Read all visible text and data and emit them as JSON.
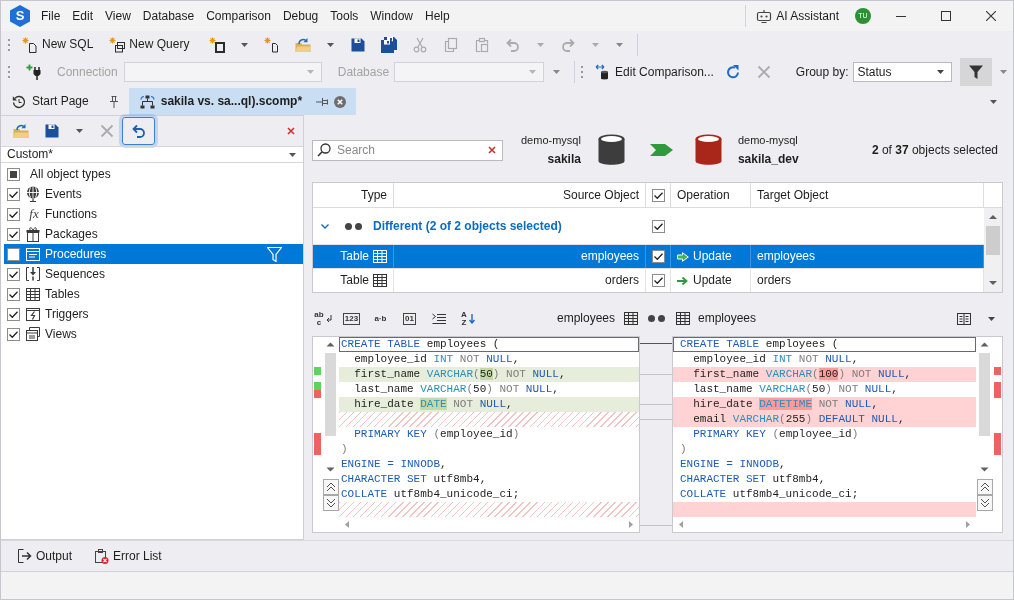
{
  "app": {
    "logo": "S",
    "menu": [
      "File",
      "Edit",
      "View",
      "Database",
      "Comparison",
      "Debug",
      "Tools",
      "Window",
      "Help"
    ],
    "assistant": "AI Assistant",
    "user_initials": "TU"
  },
  "main_toolbar": [
    {
      "kind": "new-sql",
      "label": "New SQL",
      "disabled": false,
      "dropdown": false
    },
    {
      "kind": "new-query",
      "label": "New Query",
      "disabled": false,
      "dropdown": false
    },
    {
      "kind": "new-window",
      "disabled": false,
      "dropdown": true
    },
    {
      "kind": "new-file",
      "disabled": false,
      "dropdown": false
    },
    {
      "kind": "open",
      "disabled": false,
      "dropdown": true
    },
    {
      "kind": "save",
      "disabled": false,
      "dropdown": false
    },
    {
      "kind": "save-all",
      "disabled": false,
      "dropdown": false
    },
    {
      "kind": "cut",
      "disabled": true,
      "dropdown": false
    },
    {
      "kind": "copy",
      "disabled": true,
      "dropdown": false
    },
    {
      "kind": "paste",
      "disabled": true,
      "dropdown": false
    },
    {
      "kind": "undo",
      "disabled": true,
      "dropdown": true
    },
    {
      "kind": "redo",
      "disabled": true,
      "dropdown": true
    }
  ],
  "comparison_toolbar": {
    "connection": {
      "label": "Connection",
      "disabled": true
    },
    "database": {
      "label": "Database",
      "disabled": true
    },
    "actions": [
      {
        "kind": "edit",
        "label": "Edit Comparison...",
        "disabled": false
      },
      {
        "kind": "refresh",
        "disabled": false
      },
      {
        "kind": "stop",
        "disabled": true
      }
    ],
    "group_by": {
      "label": "Group by:",
      "value": "Status"
    },
    "filter": {
      "on": true
    }
  },
  "document_tabs": [
    {
      "kind": "start",
      "label": "Start Page",
      "selected": false,
      "pinned": true
    },
    {
      "kind": "comparison",
      "label": "sakila vs. sa...ql).scomp*",
      "selected": true,
      "pinned": false
    }
  ],
  "object_types": {
    "tools": [
      {
        "kind": "open",
        "disabled": false,
        "dropdown": false,
        "focused": false
      },
      {
        "kind": "save",
        "disabled": false,
        "dropdown": true,
        "focused": false
      },
      {
        "kind": "clear",
        "disabled": true,
        "dropdown": false,
        "focused": false
      },
      {
        "kind": "undo",
        "disabled": false,
        "dropdown": false,
        "focused": true
      }
    ],
    "preset": "Custom*",
    "all_types": {
      "label": "All object types",
      "indeterminate": true
    },
    "items": [
      {
        "kind": "event",
        "label": "Events",
        "checked": true,
        "selected": false,
        "filtered": false
      },
      {
        "kind": "function",
        "glyph": "fx",
        "label": "Functions",
        "checked": true,
        "selected": false,
        "filtered": false
      },
      {
        "kind": "package",
        "label": "Packages",
        "checked": true,
        "selected": false,
        "filtered": false
      },
      {
        "kind": "procedure",
        "label": "Procedures",
        "checked": false,
        "selected": true,
        "filtered": true
      },
      {
        "kind": "sequence",
        "label": "Sequences",
        "checked": true,
        "selected": false,
        "filtered": false
      },
      {
        "kind": "table",
        "label": "Tables",
        "checked": true,
        "selected": false,
        "filtered": false
      },
      {
        "kind": "trigger",
        "label": "Triggers",
        "checked": true,
        "selected": false,
        "filtered": false
      },
      {
        "kind": "view",
        "label": "Views",
        "checked": true,
        "selected": false,
        "filtered": false
      }
    ]
  },
  "comparison": {
    "search_placeholder": "Search",
    "source": {
      "server": "demo-mysql",
      "database": "sakila"
    },
    "target": {
      "server": "demo-mysql",
      "database": "sakila_dev"
    },
    "summary": "**2** of **37** objects selected"
  },
  "results": {
    "columns": [
      "Type",
      "Source Object",
      "Operation",
      "Target Object"
    ],
    "all_checked": true,
    "groups": [
      {
        "label": "Different (2 of 2 objects selected)",
        "expanded": true,
        "checked": true,
        "rows": [
          {
            "kind": "table",
            "type": "Table",
            "source": "employees",
            "checked": true,
            "operation": "Update",
            "target": "employees",
            "selected": true
          },
          {
            "kind": "table",
            "type": "Table",
            "source": "orders",
            "checked": true,
            "operation": "Update",
            "target": "orders",
            "selected": false
          }
        ]
      }
    ]
  },
  "diff": {
    "tools": [
      {
        "kind": "case",
        "glyph": "abc"
      },
      {
        "kind": "numbers",
        "glyph": "123"
      },
      {
        "kind": "spaces",
        "glyph": "a·b"
      },
      {
        "kind": "binary",
        "glyph": "01"
      },
      {
        "kind": "indent"
      },
      {
        "kind": "sort",
        "glyph": "AZ"
      }
    ],
    "source_title": "employees",
    "target_title": "employees",
    "source_lines": [
      {
        "kind": "equal",
        "current": true,
        "tokens": [
          {
            "text": "CREATE TABLE ",
            "kind": "keyword"
          },
          {
            "text": "employees (",
            "kind": "name"
          }
        ]
      },
      {
        "kind": "equal",
        "current": false,
        "tokens": [
          {
            "text": "  employee_id ",
            "kind": "name"
          },
          {
            "text": "INT",
            "kind": "type"
          },
          {
            "text": " NOT ",
            "kind": "muted"
          },
          {
            "text": "NULL",
            "kind": "keyword"
          },
          {
            "text": ",",
            "kind": "name"
          }
        ]
      },
      {
        "kind": "modified",
        "current": false,
        "tokens": [
          {
            "text": "  first_name ",
            "kind": "name",
            "changed": false
          },
          {
            "text": "VARCHAR",
            "kind": "type",
            "changed": false
          },
          {
            "text": "(",
            "kind": "muted",
            "changed": false
          },
          {
            "text": "50",
            "kind": "name",
            "changed": true
          },
          {
            "text": ") NOT ",
            "kind": "muted",
            "changed": false
          },
          {
            "text": "NULL",
            "kind": "keyword",
            "changed": false
          },
          {
            "text": ",",
            "kind": "name",
            "changed": false
          }
        ]
      },
      {
        "kind": "equal",
        "current": false,
        "tokens": [
          {
            "text": "  last_name ",
            "kind": "name"
          },
          {
            "text": "VARCHAR",
            "kind": "type"
          },
          {
            "text": "(",
            "kind": "muted"
          },
          {
            "text": "50",
            "kind": "name"
          },
          {
            "text": ") NOT ",
            "kind": "muted"
          },
          {
            "text": "NULL",
            "kind": "keyword"
          },
          {
            "text": ",",
            "kind": "name"
          }
        ]
      },
      {
        "kind": "modified",
        "current": false,
        "tokens": [
          {
            "text": "  hire_date ",
            "kind": "name",
            "changed": false
          },
          {
            "text": "DATE",
            "kind": "type",
            "changed": true
          },
          {
            "text": " NOT ",
            "kind": "muted",
            "changed": false
          },
          {
            "text": "NULL",
            "kind": "keyword",
            "changed": false
          },
          {
            "text": ",",
            "kind": "name",
            "changed": false
          }
        ]
      },
      {
        "kind": "gap",
        "current": false
      },
      {
        "kind": "equal",
        "current": false,
        "tokens": [
          {
            "text": "  PRIMARY KEY ",
            "kind": "keyword"
          },
          {
            "text": "(",
            "kind": "muted"
          },
          {
            "text": "employee_id",
            "kind": "name"
          },
          {
            "text": ")",
            "kind": "muted"
          }
        ]
      },
      {
        "kind": "equal",
        "current": false,
        "tokens": [
          {
            "text": ")",
            "kind": "muted"
          }
        ]
      },
      {
        "kind": "equal",
        "current": false,
        "tokens": [
          {
            "text": "ENGINE = INNODB",
            "kind": "keyword"
          },
          {
            "text": ",",
            "kind": "name"
          }
        ]
      },
      {
        "kind": "equal",
        "current": false,
        "tokens": [
          {
            "text": "CHARACTER SET ",
            "kind": "keyword"
          },
          {
            "text": "utf8mb4,",
            "kind": "name"
          }
        ]
      },
      {
        "kind": "equal",
        "current": false,
        "tokens": [
          {
            "text": "COLLATE ",
            "kind": "keyword"
          },
          {
            "text": "utf8mb4_unicode_ci;",
            "kind": "name"
          }
        ]
      },
      {
        "kind": "gap",
        "current": false
      }
    ],
    "target_lines": [
      {
        "kind": "equal",
        "current": true,
        "tokens": [
          {
            "text": "CREATE TABLE ",
            "kind": "keyword"
          },
          {
            "text": "employees (",
            "kind": "name"
          }
        ]
      },
      {
        "kind": "equal",
        "current": false,
        "tokens": [
          {
            "text": "  employee_id ",
            "kind": "name"
          },
          {
            "text": "INT",
            "kind": "type"
          },
          {
            "text": " NOT ",
            "kind": "muted"
          },
          {
            "text": "NULL",
            "kind": "keyword"
          },
          {
            "text": ",",
            "kind": "name"
          }
        ]
      },
      {
        "kind": "modified",
        "current": false,
        "tokens": [
          {
            "text": "  first_name ",
            "kind": "name",
            "changed": false
          },
          {
            "text": "VARCHAR",
            "kind": "type",
            "changed": false
          },
          {
            "text": "(",
            "kind": "muted",
            "changed": false
          },
          {
            "text": "100",
            "kind": "name",
            "changed": true
          },
          {
            "text": ") NOT ",
            "kind": "muted",
            "changed": false
          },
          {
            "text": "NULL",
            "kind": "keyword",
            "changed": false
          },
          {
            "text": ",",
            "kind": "name",
            "changed": false
          }
        ]
      },
      {
        "kind": "equal",
        "current": false,
        "tokens": [
          {
            "text": "  last_name ",
            "kind": "name"
          },
          {
            "text": "VARCHAR",
            "kind": "type"
          },
          {
            "text": "(",
            "kind": "muted"
          },
          {
            "text": "50",
            "kind": "name"
          },
          {
            "text": ") NOT ",
            "kind": "muted"
          },
          {
            "text": "NULL",
            "kind": "keyword"
          },
          {
            "text": ",",
            "kind": "name"
          }
        ]
      },
      {
        "kind": "modified",
        "current": false,
        "tokens": [
          {
            "text": "  hire_date ",
            "kind": "name",
            "changed": false
          },
          {
            "text": "DATETIME",
            "kind": "type",
            "changed": true
          },
          {
            "text": " NOT ",
            "kind": "muted",
            "changed": false
          },
          {
            "text": "NULL",
            "kind": "keyword",
            "changed": false
          },
          {
            "text": ",",
            "kind": "name",
            "changed": false
          }
        ]
      },
      {
        "kind": "modified",
        "current": false,
        "tokens": [
          {
            "text": "  email ",
            "kind": "name",
            "changed": false
          },
          {
            "text": "VARCHAR",
            "kind": "type",
            "changed": false
          },
          {
            "text": "(",
            "kind": "muted",
            "changed": false
          },
          {
            "text": "255",
            "kind": "name",
            "changed": false
          },
          {
            "text": ") ",
            "kind": "muted",
            "changed": false
          },
          {
            "text": "DEFAULT NULL",
            "kind": "keyword",
            "changed": false
          },
          {
            "text": ",",
            "kind": "name",
            "changed": false
          }
        ]
      },
      {
        "kind": "equal",
        "current": false,
        "tokens": [
          {
            "text": "  PRIMARY KEY ",
            "kind": "keyword"
          },
          {
            "text": "(",
            "kind": "muted"
          },
          {
            "text": "employee_id",
            "kind": "name"
          },
          {
            "text": ")",
            "kind": "muted"
          }
        ]
      },
      {
        "kind": "equal",
        "current": false,
        "tokens": [
          {
            "text": ")",
            "kind": "muted"
          }
        ]
      },
      {
        "kind": "equal",
        "current": false,
        "tokens": [
          {
            "text": "ENGINE = INNODB",
            "kind": "keyword"
          },
          {
            "text": ",",
            "kind": "name"
          }
        ]
      },
      {
        "kind": "equal",
        "current": false,
        "tokens": [
          {
            "text": "CHARACTER SET ",
            "kind": "keyword"
          },
          {
            "text": "utf8mb4,",
            "kind": "name"
          }
        ]
      },
      {
        "kind": "equal",
        "current": false,
        "tokens": [
          {
            "text": "COLLATE ",
            "kind": "keyword"
          },
          {
            "text": "utf8mb4_unicode_ci;",
            "kind": "name"
          }
        ]
      },
      {
        "kind": "modified",
        "current": false
      }
    ]
  },
  "bottom_tabs": [
    {
      "kind": "output",
      "label": "Output"
    },
    {
      "kind": "errors",
      "label": "Error List"
    }
  ]
}
